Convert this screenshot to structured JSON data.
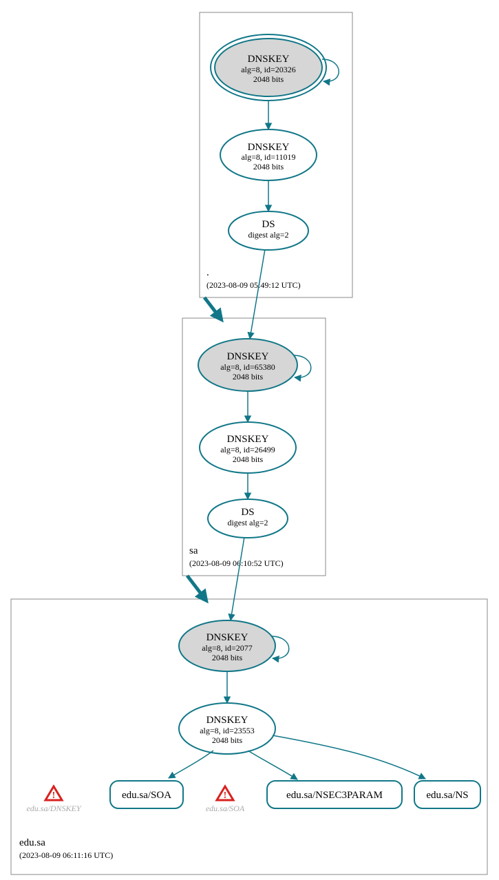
{
  "colors": {
    "teal": "#117788",
    "grayFill": "#d6d6d6",
    "boxStroke": "#888888",
    "ghost": "#aaaaaa",
    "warnRed": "#d8221f"
  },
  "zones": {
    "root": {
      "label": ".",
      "timestamp": "(2023-08-09 05:49:12 UTC)"
    },
    "sa": {
      "label": "sa",
      "timestamp": "(2023-08-09 06:10:52 UTC)"
    },
    "edusa": {
      "label": "edu.sa",
      "timestamp": "(2023-08-09 06:11:16 UTC)"
    }
  },
  "nodes": {
    "rootKsk": {
      "title": "DNSKEY",
      "line2": "alg=8, id=20326",
      "line3": "2048 bits"
    },
    "rootZsk": {
      "title": "DNSKEY",
      "line2": "alg=8, id=11019",
      "line3": "2048 bits"
    },
    "rootDs": {
      "title": "DS",
      "line2": "digest alg=2"
    },
    "saKsk": {
      "title": "DNSKEY",
      "line2": "alg=8, id=65380",
      "line3": "2048 bits"
    },
    "saZsk": {
      "title": "DNSKEY",
      "line2": "alg=8, id=26499",
      "line3": "2048 bits"
    },
    "saDs": {
      "title": "DS",
      "line2": "digest alg=2"
    },
    "eduKsk": {
      "title": "DNSKEY",
      "line2": "alg=8, id=2077",
      "line3": "2048 bits"
    },
    "eduZsk": {
      "title": "DNSKEY",
      "line2": "alg=8, id=23553",
      "line3": "2048 bits"
    }
  },
  "rrsets": {
    "soa": "edu.sa/SOA",
    "nsec3": "edu.sa/NSEC3PARAM",
    "ns": "edu.sa/NS"
  },
  "ghosts": {
    "dnskey": "edu.sa/DNSKEY",
    "soa": "edu.sa/SOA"
  }
}
